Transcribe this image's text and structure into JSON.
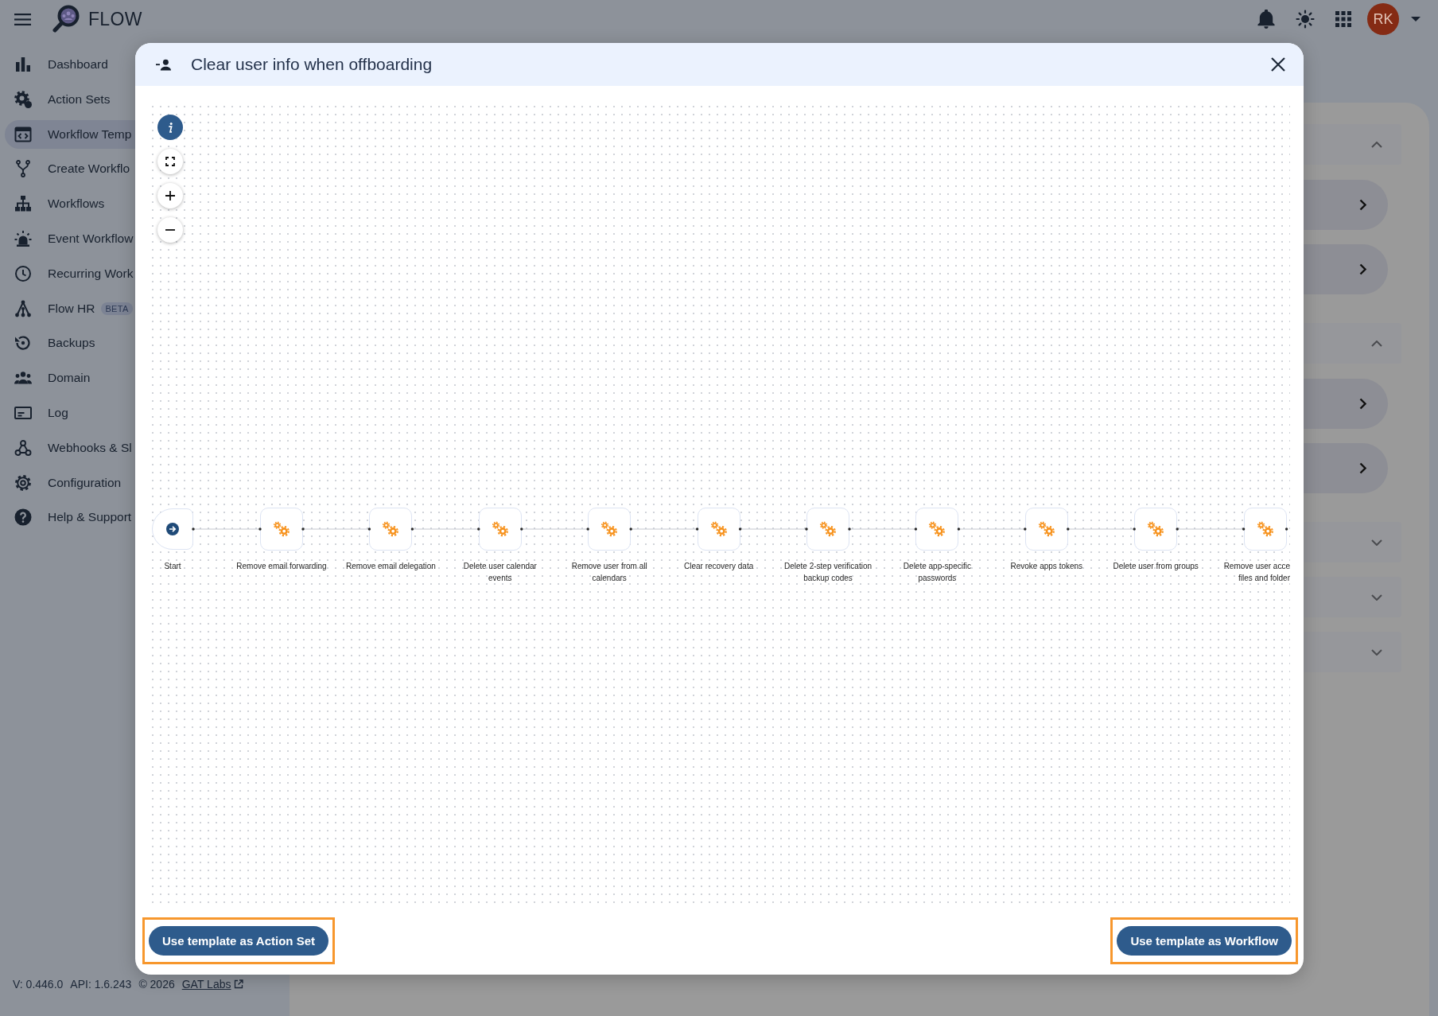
{
  "header": {
    "logo_text": "FLOW",
    "avatar_initials": "RK"
  },
  "sidebar": {
    "items": [
      {
        "label": "Dashboard",
        "selected": false
      },
      {
        "label": "Action Sets",
        "selected": false
      },
      {
        "label": "Workflow Temp",
        "selected": true
      },
      {
        "label": "Create Workflo",
        "selected": false
      },
      {
        "label": "Workflows",
        "selected": false
      },
      {
        "label": "Event Workflow",
        "selected": false
      },
      {
        "label": "Recurring Work",
        "selected": false
      },
      {
        "label": "Flow HR",
        "selected": false,
        "badge": "BETA"
      },
      {
        "label": "Backups",
        "selected": false
      },
      {
        "label": "Domain",
        "selected": false
      },
      {
        "label": "Log",
        "selected": false
      },
      {
        "label": "Webhooks & Sl",
        "selected": false
      },
      {
        "label": "Configuration",
        "selected": false
      },
      {
        "label": "Help & Support",
        "selected": false
      }
    ]
  },
  "footer": {
    "version": "V: 0.446.0",
    "api": "API: 1.6.243",
    "copyright": "© 2026",
    "link": "GAT Labs"
  },
  "background_sections": [
    {
      "expanded": true,
      "rows": [
        {
          "kind": "link"
        },
        {
          "kind": "link"
        }
      ]
    },
    {
      "expanded": true,
      "rows": [
        {
          "kind": "link"
        },
        {
          "kind": "link"
        }
      ]
    },
    {
      "expanded": false
    },
    {
      "expanded": false
    },
    {
      "expanded": false
    }
  ],
  "modal": {
    "title": "Clear user info when offboarding",
    "nodes": [
      {
        "kind": "start",
        "lines": [
          "Start"
        ]
      },
      {
        "kind": "action",
        "lines": [
          "Remove email forwarding"
        ]
      },
      {
        "kind": "action",
        "lines": [
          "Remove email delegation"
        ]
      },
      {
        "kind": "action",
        "lines": [
          "Delete user calendar",
          "events"
        ]
      },
      {
        "kind": "action",
        "lines": [
          "Remove user from all",
          "calendars"
        ]
      },
      {
        "kind": "action",
        "lines": [
          "Clear recovery data"
        ]
      },
      {
        "kind": "action",
        "lines": [
          "Delete 2-step verification",
          "backup codes"
        ]
      },
      {
        "kind": "action",
        "lines": [
          "Delete app-specific",
          "passwords"
        ]
      },
      {
        "kind": "action",
        "lines": [
          "Revoke apps tokens"
        ]
      },
      {
        "kind": "action",
        "lines": [
          "Delete user from groups"
        ]
      },
      {
        "kind": "action",
        "lines": [
          "Remove user acce",
          "files and folder"
        ]
      }
    ],
    "buttons": [
      {
        "label": "Use template as Action Set",
        "highlighted": true
      },
      {
        "label": "Use template as Workflow",
        "highlighted": true
      }
    ]
  }
}
